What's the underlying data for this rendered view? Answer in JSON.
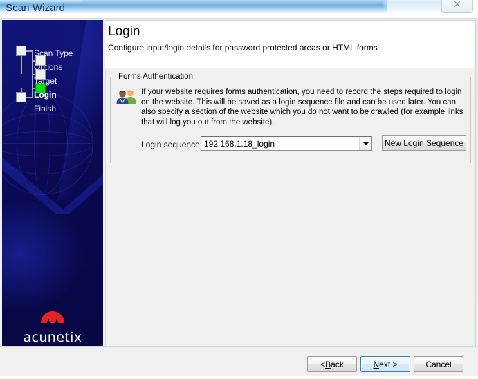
{
  "window": {
    "title": "Scan Wizard",
    "close_icon": "close-icon",
    "close_glyph": "✕"
  },
  "sidebar": {
    "steps": [
      {
        "label": "Scan Type",
        "state": "pending",
        "indent": 0
      },
      {
        "label": "Options",
        "state": "pending",
        "indent": 1
      },
      {
        "label": "Target",
        "state": "pending",
        "indent": 1
      },
      {
        "label": "Login",
        "state": "active",
        "indent": 1
      },
      {
        "label": "Finish",
        "state": "pending",
        "indent": 0
      }
    ],
    "brand": {
      "name": "acunetix",
      "logo_icon": "acunetix-arch-logo-icon",
      "logo_color": "#e8201f"
    },
    "background_color": "#0b0b5c",
    "active_node_color": "#00e000"
  },
  "header": {
    "title": "Login",
    "subtitle": "Configure input/login details for password protected areas or HTML forms"
  },
  "main": {
    "group": {
      "legend": "Forms Authentication",
      "icon": "two-users-icon",
      "description": "If your website requires forms authentication, you need to record the steps required to login on the website. This will be saved as a login sequence file and can be used later. You can also specify a section of the website which you do not want to be crawled (for example links that will log you out from the website).",
      "field": {
        "label": "Login sequence:",
        "value": "192.168.1.18_login",
        "placeholder": "",
        "dropdown_icon": "chevron-down-icon",
        "button_label": "New Login Sequence"
      }
    }
  },
  "footer": {
    "back": {
      "prefix": "< ",
      "accel": "B",
      "rest": "ack"
    },
    "next": {
      "prefix": "",
      "accel": "N",
      "rest": "ext >"
    },
    "cancel": {
      "label": "Cancel"
    },
    "default_button": "next",
    "default_button_accent": "#3c7fb1"
  }
}
